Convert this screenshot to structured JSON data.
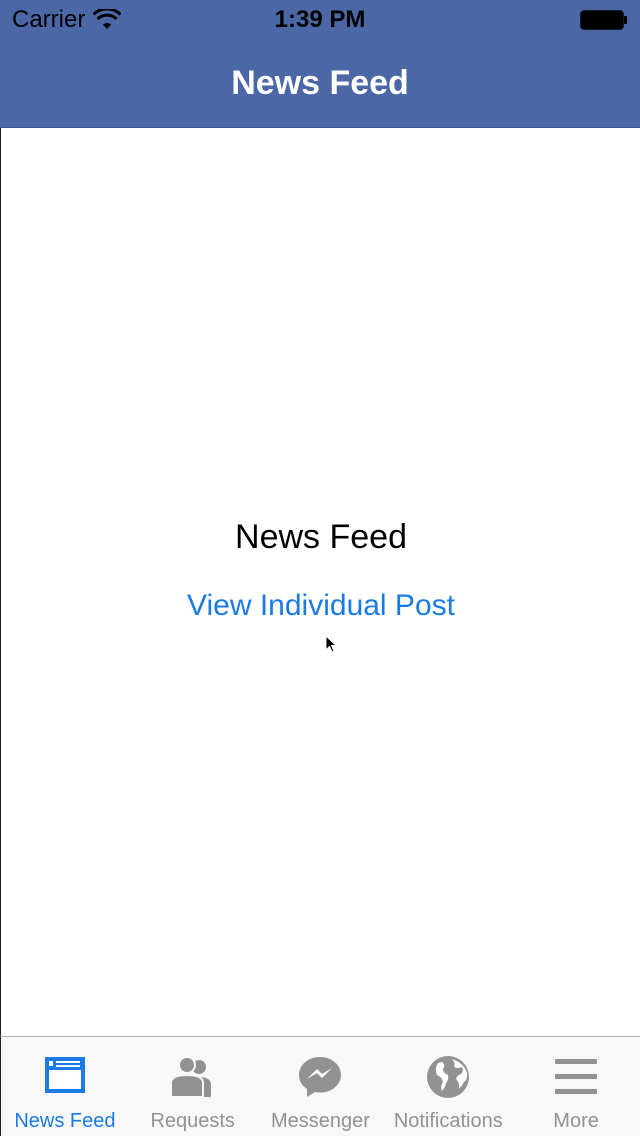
{
  "status_bar": {
    "carrier": "Carrier",
    "time": "1:39 PM"
  },
  "nav_bar": {
    "title": "News Feed"
  },
  "content": {
    "title": "News Feed",
    "link": "View Individual Post"
  },
  "tab_bar": {
    "tabs": [
      {
        "label": "News Feed",
        "icon": "news-feed-icon",
        "active": true
      },
      {
        "label": "Requests",
        "icon": "requests-icon",
        "active": false
      },
      {
        "label": "Messenger",
        "icon": "messenger-icon",
        "active": false
      },
      {
        "label": "Notifications",
        "icon": "globe-icon",
        "active": false
      },
      {
        "label": "More",
        "icon": "hamburger-menu-icon",
        "active": false
      }
    ]
  },
  "colors": {
    "nav_background": "#4c67a6",
    "accent": "#1a7ae6",
    "inactive": "#929292"
  }
}
